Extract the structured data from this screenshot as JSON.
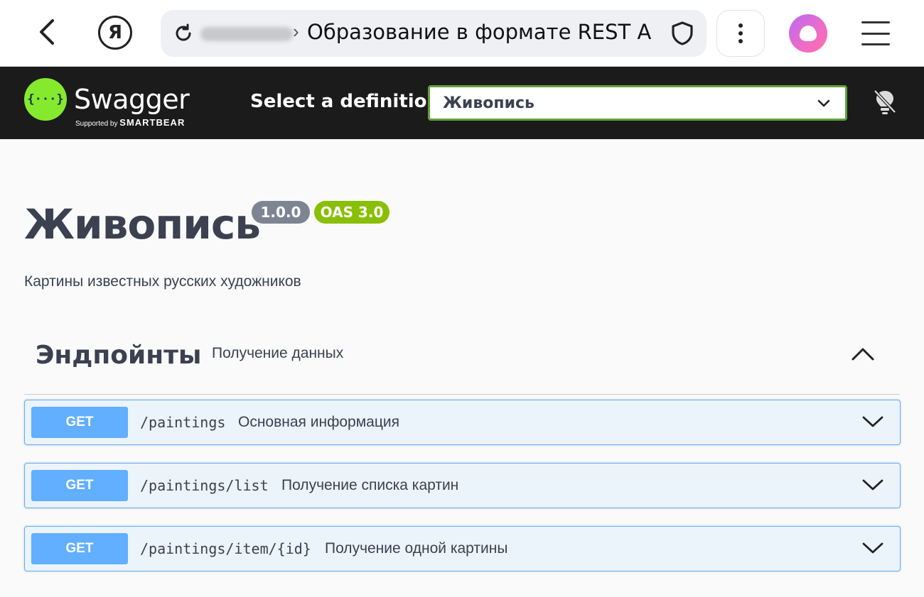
{
  "browser": {
    "yandex_glyph": "Я",
    "breadcrumb_sep": "›",
    "tab_title": "Образование в формате REST API"
  },
  "topbar": {
    "brand": "Swagger",
    "supported_by": "Supported by",
    "supported_brand": "SMARTBEAR",
    "logo_glyph": "{···}",
    "select_label": "Select a definition",
    "selected_definition": "Живопись"
  },
  "info": {
    "title": "Живопись",
    "version": "1.0.0",
    "oas": "OAS 3.0",
    "description": "Картины известных русских художников"
  },
  "tag": {
    "name": "Эндпойнты",
    "description": "Получение данных"
  },
  "operations": [
    {
      "method": "GET",
      "path": "/paintings",
      "summary": "Основная информация"
    },
    {
      "method": "GET",
      "path": "/paintings/list",
      "summary": "Получение списка картин"
    },
    {
      "method": "GET",
      "path": "/paintings/item/{id}",
      "summary": "Получение одной картины"
    }
  ],
  "colors": {
    "get_method": "#61affe",
    "get_bg": "#ebf3fb",
    "swagger_green": "#85ea2d",
    "topbar_bg": "#1b1b1b",
    "oas_badge": "#89bf04",
    "version_badge": "#7d8492"
  },
  "icons": {
    "back": "back-arrow-icon",
    "yandex": "yandex-logo-icon",
    "reload": "reload-icon",
    "shield": "shield-icon",
    "menu": "more-vertical-icon",
    "alice": "alice-assistant-icon",
    "hamburger": "hamburger-menu-icon",
    "bulb": "lightbulb-off-icon",
    "chevron_down": "chevron-down-icon",
    "chevron_up": "chevron-up-icon"
  }
}
